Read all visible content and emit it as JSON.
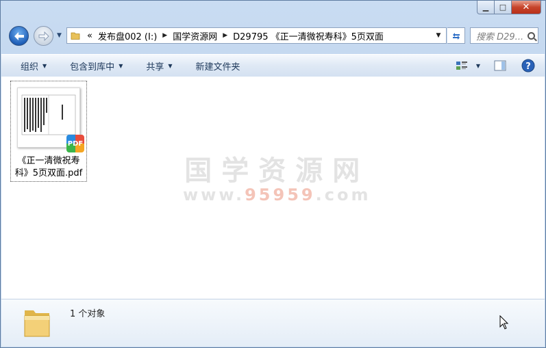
{
  "address": {
    "overflow": "«",
    "crumbs": [
      "发布盘002 (I:)",
      "国学资源网",
      "D29795 《正一清微祝寿科》5页双面"
    ]
  },
  "search": {
    "placeholder": "搜索 D29..."
  },
  "toolbar": {
    "organize": "组织",
    "include_library": "包含到库中",
    "share": "共享",
    "new_folder": "新建文件夹"
  },
  "file": {
    "name": "《正一清微祝寿科》5页双面.pdf",
    "badge": "PDF"
  },
  "watermark": {
    "line1": "国学资源网",
    "line2_prefix": "www.",
    "line2_num": "95959",
    "line2_suffix": ".com"
  },
  "details": {
    "count": "1 个对象"
  }
}
